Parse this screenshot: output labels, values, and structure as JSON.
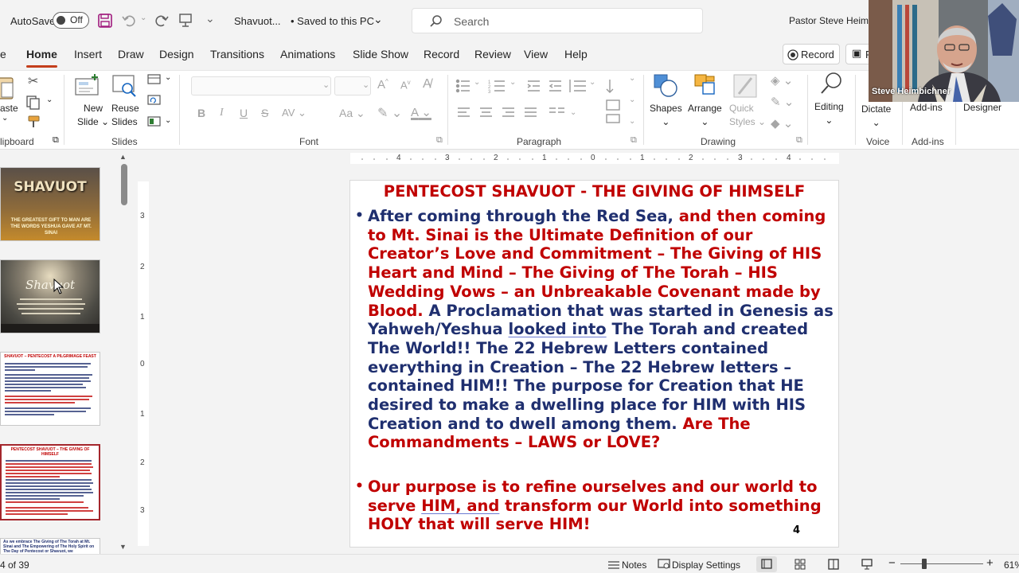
{
  "titlebar": {
    "autosave_label": "AutoSave",
    "autosave_state": "Off",
    "doc_title": "Shavuot...",
    "save_status": "• Saved to this PC",
    "search_placeholder": "Search",
    "user_name": "Pastor Steve Heimbic"
  },
  "tabs": [
    "e",
    "Home",
    "Insert",
    "Draw",
    "Design",
    "Transitions",
    "Animations",
    "Slide Show",
    "Record",
    "Review",
    "View",
    "Help"
  ],
  "record_button": "Record",
  "present_button": "P",
  "ribbon": {
    "clipboard": {
      "paste": "aste",
      "group": "lipboard"
    },
    "slides": {
      "new_slide": [
        "New",
        "Slide"
      ],
      "reuse_slides": [
        "Reuse",
        "Slides"
      ],
      "group": "Slides"
    },
    "font": {
      "group": "Font",
      "bold": "B",
      "italic": "I",
      "underline": "U",
      "strike": "S",
      "spacing": "AV",
      "case": "Aa",
      "font_color": "A",
      "grow": "A",
      "shrink": "A"
    },
    "paragraph": {
      "group": "Paragraph"
    },
    "drawing": {
      "shapes": "Shapes",
      "arrange": "Arrange",
      "quick_styles": [
        "Quick",
        "Styles"
      ],
      "group": "Drawing"
    },
    "editing": {
      "label": "Editing"
    },
    "voice": {
      "dictate": "Dictate",
      "group": "Voice"
    },
    "addins": {
      "label": "Add-ins",
      "group": "Add-ins"
    },
    "designer": {
      "label": "Designer"
    }
  },
  "thumbnails": [
    {
      "title": "SHAVUOT",
      "caption": "THE GREATEST GIFT TO MAN ARE THE WORDS YESHUA GAVE AT MT. SINAI"
    },
    {
      "title": "Shavuot",
      "caption": ""
    },
    {
      "title": "SHAVUOT – PENTECOST A PILGRIMAGE FEAST",
      "caption": ""
    },
    {
      "title": "PENTECOST SHAVUOT – THE GIVING OF HIMSELF",
      "caption": ""
    },
    {
      "title": "As we embrace The Giving of The Torah at Mt. Sinai and The Empowering of The Holy Spirit on The Day of Pentecost or Shavuot, we",
      "caption": ""
    }
  ],
  "ruler": {
    "h": [
      "4",
      "3",
      "2",
      "1",
      "0",
      "1",
      "2",
      "3",
      "4"
    ],
    "v": [
      "3",
      "2",
      "1",
      "0",
      "1",
      "2",
      "3"
    ]
  },
  "slide": {
    "title": "PENTECOST SHAVUOT - THE GIVING OF HIMSELF",
    "bullet1": {
      "seg1": "After coming through the Red Sea, ",
      "seg2": "and then coming to Mt. Sinai is the Ultimate Definition of our Creator’s Love and Commitment – The Giving of HIS Heart and Mind – The Giving of The Torah – HIS Wedding Vows – an Unbreakable Covenant made by Blood. ",
      "seg3": "A Proclamation that was started in Genesis as Yahweh/Yeshua ",
      "seg3_ul": "looked into",
      "seg4": " The Torah and created The World!!  The 22 Hebrew Letters contained everything in Creation – The 22 Hebrew letters – contained HIM!!  The purpose for Creation that HE desired to make a dwelling place for HIM with HIS Creation and to dwell among them.  ",
      "seg5": "Are The Commandments – LAWS or LOVE?"
    },
    "bullet2": {
      "seg1": "Our purpose is to refine ourselves and our world to serve ",
      "seg1_ul": "HIM, and",
      "seg2": " transform our World into something HOLY that will serve HIM!"
    },
    "page_number": "4"
  },
  "statusbar": {
    "slide_count": "4 of 39",
    "notes": "Notes",
    "display_settings": "Display Settings",
    "zoom": "61%"
  },
  "webcam": {
    "name": "Steve Heimbichner"
  }
}
